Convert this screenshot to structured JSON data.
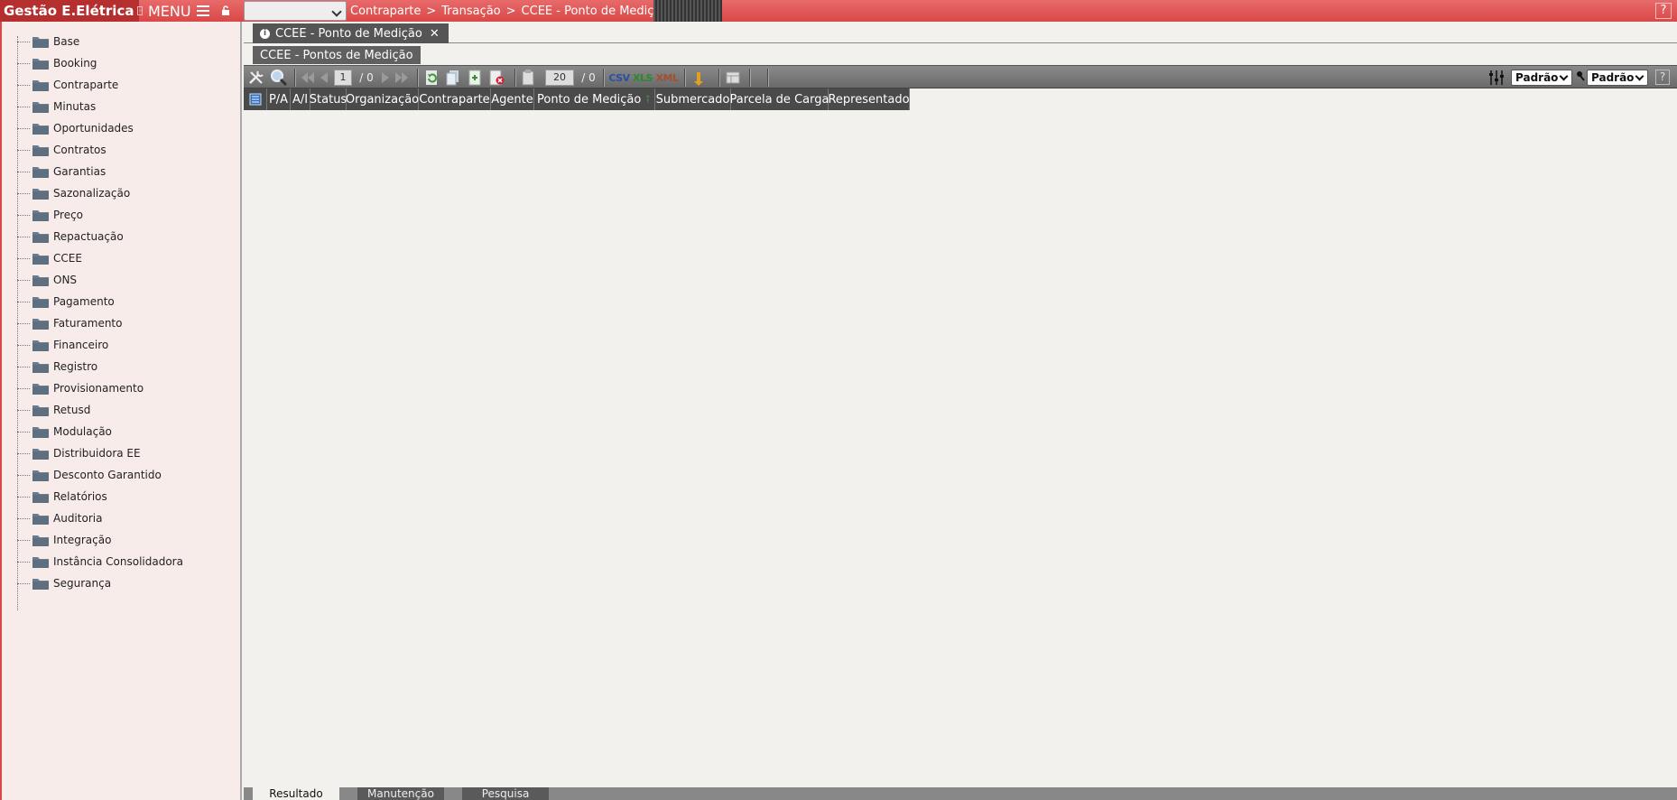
{
  "app": {
    "title": "Gestão E.Elétrica",
    "menu_label": "MENU",
    "breadcrumb": [
      "Contraparte",
      "Transação",
      "CCEE - Ponto de Medição"
    ],
    "help": "?"
  },
  "sidebar": {
    "items": [
      {
        "label": "Base"
      },
      {
        "label": "Booking"
      },
      {
        "label": "Contraparte"
      },
      {
        "label": "Minutas"
      },
      {
        "label": "Oportunidades"
      },
      {
        "label": "Contratos"
      },
      {
        "label": "Garantias"
      },
      {
        "label": "Sazonalização"
      },
      {
        "label": "Preço"
      },
      {
        "label": "Repactuação"
      },
      {
        "label": "CCEE"
      },
      {
        "label": "ONS"
      },
      {
        "label": "Pagamento"
      },
      {
        "label": "Faturamento"
      },
      {
        "label": "Financeiro"
      },
      {
        "label": "Registro"
      },
      {
        "label": "Provisionamento"
      },
      {
        "label": "Retusd"
      },
      {
        "label": "Modulação"
      },
      {
        "label": "Distribuidora EE"
      },
      {
        "label": "Desconto Garantido"
      },
      {
        "label": "Relatórios"
      },
      {
        "label": "Auditoria"
      },
      {
        "label": "Integração"
      },
      {
        "label": "Instância Consolidadora"
      },
      {
        "label": "Segurança"
      }
    ]
  },
  "main": {
    "doc_tab": "CCEE - Ponto de Medição",
    "sub_tab": "CCEE - Pontos de Medição",
    "toolbar": {
      "page_current": "1",
      "page_total": "/ 0",
      "page_size": "20",
      "records_total": "/ 0",
      "csv": "CSV",
      "xls": "XLS",
      "xml": "XML",
      "view_select": "Padrão",
      "filter_select": "Padrão",
      "help": "?"
    },
    "columns": [
      "P/A",
      "A/I",
      "Status",
      "Organização",
      "Contraparte",
      "Agente",
      "Ponto de Medição",
      "Submercado",
      "Parcela de Carga",
      "Representado"
    ],
    "bottom_tabs": [
      "Resultado",
      "Manutenção",
      "Pesquisa"
    ]
  },
  "colors": {
    "topbar": "#d94848",
    "brand_bg": "#b52f2f",
    "toolbar": "#767676",
    "grid_header": "#4a4a4a",
    "folder": "#6b7d8f"
  }
}
